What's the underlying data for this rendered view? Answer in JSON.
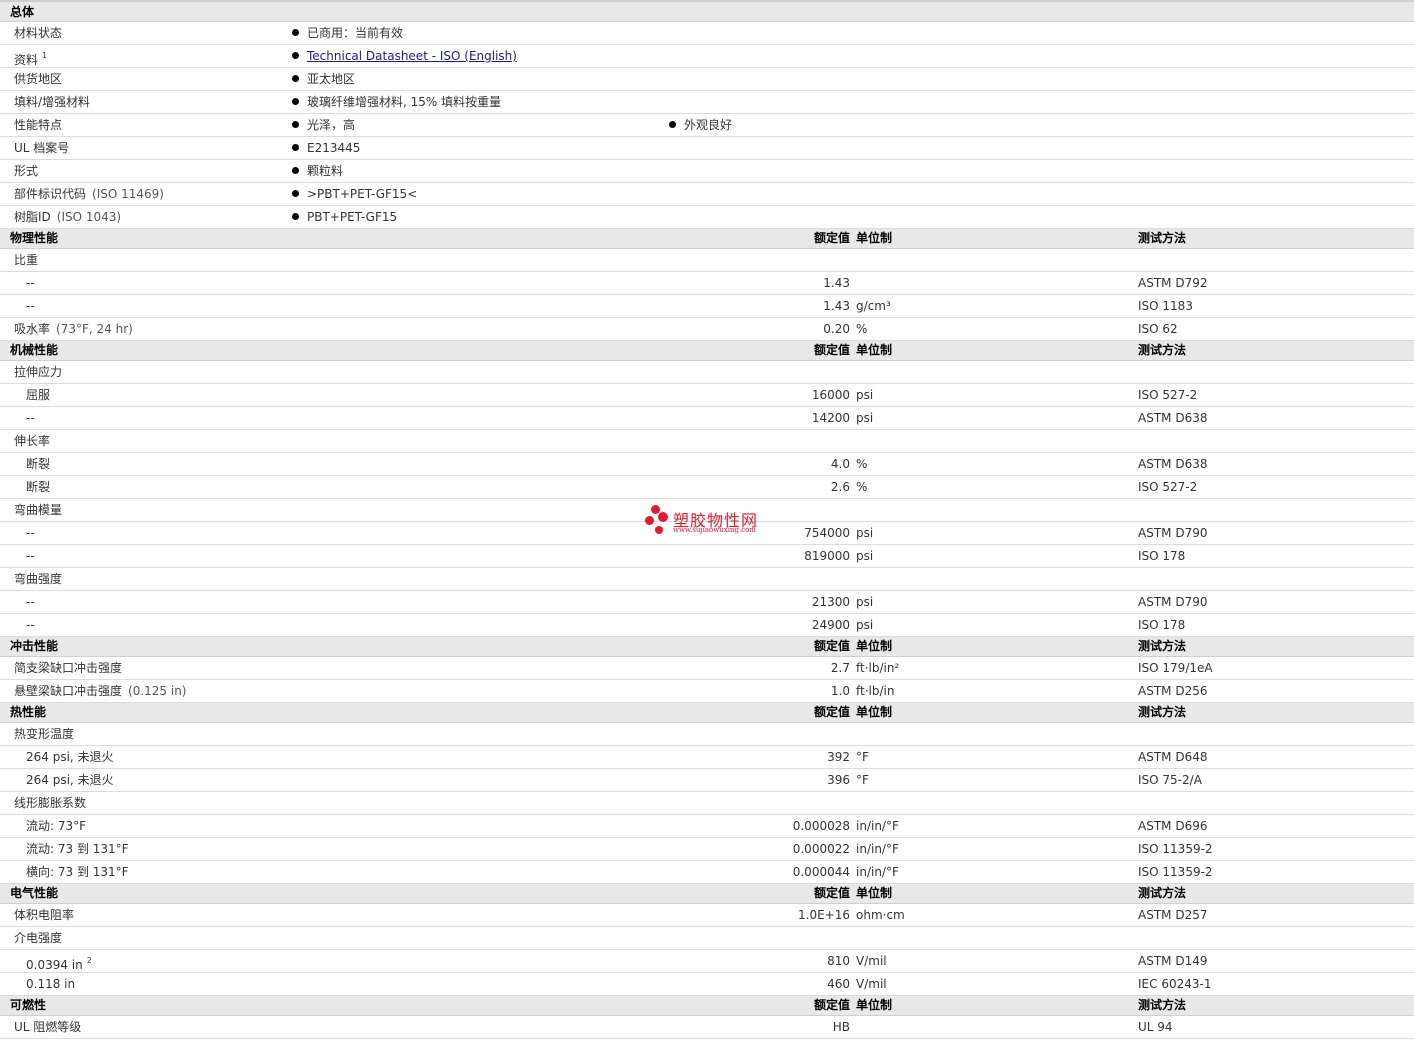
{
  "watermark": {
    "name": "塑胶物性网",
    "url": "www.sujiaowuxing.com"
  },
  "rows": [
    {
      "type": "section",
      "name": "总体"
    },
    {
      "type": "info",
      "name": "材料状态",
      "bullets": [
        "已商用：当前有效"
      ]
    },
    {
      "type": "info",
      "name": "资料",
      "sup": "1",
      "bullets": [
        "Technical Datasheet - ISO (English)"
      ],
      "link": true
    },
    {
      "type": "info",
      "name": "供货地区",
      "bullets": [
        "亚太地区"
      ]
    },
    {
      "type": "info",
      "name": "填料/增强材料",
      "bullets": [
        "玻璃纤维增强材料, 15% 填料按重量"
      ]
    },
    {
      "type": "info",
      "name": "性能特点",
      "bullets": [
        "光泽，高",
        "外观良好"
      ]
    },
    {
      "type": "info",
      "name": "UL 档案号",
      "bullets": [
        "E213445"
      ]
    },
    {
      "type": "info",
      "name": "形式",
      "bullets": [
        "颗粒料"
      ]
    },
    {
      "type": "info",
      "name": "部件标识代码",
      "note": "(ISO 11469)",
      "bullets": [
        ">PBT+PET-GF15<"
      ]
    },
    {
      "type": "info",
      "name": "树脂ID",
      "note": "(ISO 1043)",
      "bullets": [
        "PBT+PET-GF15"
      ]
    },
    {
      "type": "section",
      "name": "物理性能",
      "val": "额定值",
      "unit": "单位制",
      "test": "测试方法"
    },
    {
      "type": "group",
      "name": "比重"
    },
    {
      "type": "data",
      "sub": true,
      "name": "--",
      "val": "1.43",
      "unit": "",
      "test": "ASTM D792"
    },
    {
      "type": "data",
      "sub": true,
      "name": "--",
      "val": "1.43",
      "unit": "g/cm³",
      "test": "ISO 1183"
    },
    {
      "type": "data",
      "name": "吸水率",
      "note": "(73°F, 24 hr)",
      "val": "0.20",
      "unit": "%",
      "test": "ISO 62"
    },
    {
      "type": "section",
      "name": "机械性能",
      "val": "额定值",
      "unit": "单位制",
      "test": "测试方法"
    },
    {
      "type": "group",
      "name": "拉伸应力"
    },
    {
      "type": "data",
      "sub": true,
      "name": "屈服",
      "val": "16000",
      "unit": "psi",
      "test": "ISO 527-2"
    },
    {
      "type": "data",
      "sub": true,
      "name": "--",
      "val": "14200",
      "unit": "psi",
      "test": "ASTM D638"
    },
    {
      "type": "group",
      "name": "伸长率"
    },
    {
      "type": "data",
      "sub": true,
      "name": "断裂",
      "val": "4.0",
      "unit": "%",
      "test": "ASTM D638"
    },
    {
      "type": "data",
      "sub": true,
      "name": "断裂",
      "val": "2.6",
      "unit": "%",
      "test": "ISO 527-2"
    },
    {
      "type": "group",
      "name": "弯曲模量"
    },
    {
      "type": "data",
      "sub": true,
      "name": "--",
      "val": "754000",
      "unit": "psi",
      "test": "ASTM D790"
    },
    {
      "type": "data",
      "sub": true,
      "name": "--",
      "val": "819000",
      "unit": "psi",
      "test": "ISO 178"
    },
    {
      "type": "group",
      "name": "弯曲强度"
    },
    {
      "type": "data",
      "sub": true,
      "name": "--",
      "val": "21300",
      "unit": "psi",
      "test": "ASTM D790"
    },
    {
      "type": "data",
      "sub": true,
      "name": "--",
      "val": "24900",
      "unit": "psi",
      "test": "ISO 178"
    },
    {
      "type": "section",
      "name": "冲击性能",
      "val": "额定值",
      "unit": "单位制",
      "test": "测试方法"
    },
    {
      "type": "data",
      "name": "简支梁缺口冲击强度",
      "val": "2.7",
      "unit": "ft·lb/in²",
      "test": "ISO 179/1eA"
    },
    {
      "type": "data",
      "name": "悬壁梁缺口冲击强度",
      "note": "(0.125 in)",
      "val": "1.0",
      "unit": "ft·lb/in",
      "test": "ASTM D256"
    },
    {
      "type": "section",
      "name": "热性能",
      "val": "额定值",
      "unit": "单位制",
      "test": "测试方法"
    },
    {
      "type": "group",
      "name": "热变形温度"
    },
    {
      "type": "data",
      "sub": true,
      "name": "264 psi, 未退火",
      "val": "392",
      "unit": "°F",
      "test": "ASTM D648"
    },
    {
      "type": "data",
      "sub": true,
      "name": "264 psi, 未退火",
      "val": "396",
      "unit": "°F",
      "test": "ISO 75-2/A"
    },
    {
      "type": "group",
      "name": "线形膨胀系数"
    },
    {
      "type": "data",
      "sub": true,
      "name": "流动: 73°F",
      "val": "0.000028",
      "unit": "in/in/°F",
      "test": "ASTM D696"
    },
    {
      "type": "data",
      "sub": true,
      "name": "流动: 73 到  131°F",
      "val": "0.000022",
      "unit": "in/in/°F",
      "test": "ISO 11359-2"
    },
    {
      "type": "data",
      "sub": true,
      "name": "横向: 73 到  131°F",
      "val": "0.000044",
      "unit": "in/in/°F",
      "test": "ISO 11359-2"
    },
    {
      "type": "section",
      "name": "电气性能",
      "val": "额定值",
      "unit": "单位制",
      "test": "测试方法"
    },
    {
      "type": "data",
      "name": "体积电阻率",
      "val": "1.0E+16",
      "unit": "ohm·cm",
      "test": "ASTM D257"
    },
    {
      "type": "group",
      "name": "介电强度"
    },
    {
      "type": "data",
      "sub": true,
      "name": "0.0394 in",
      "sup": "2",
      "val": "810",
      "unit": "V/mil",
      "test": "ASTM D149"
    },
    {
      "type": "data",
      "sub": true,
      "name": "0.118 in",
      "val": "460",
      "unit": "V/mil",
      "test": "IEC 60243-1"
    },
    {
      "type": "section",
      "name": "可燃性",
      "val": "额定值",
      "unit": "单位制",
      "test": "测试方法"
    },
    {
      "type": "data",
      "name": "UL 阻燃等级",
      "val": "HB",
      "unit": "",
      "test": "UL 94"
    }
  ]
}
